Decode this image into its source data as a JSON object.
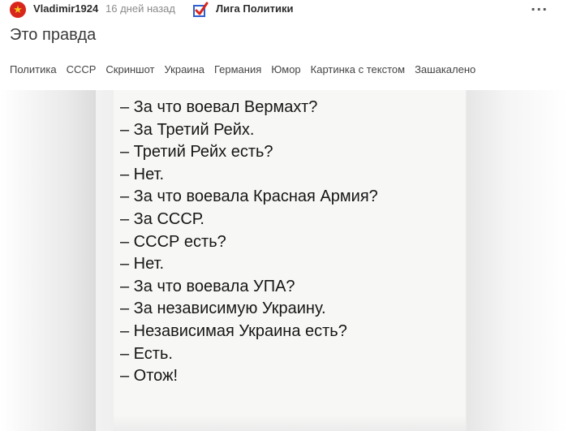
{
  "post": {
    "author": "Vladimir1924",
    "time": "16 дней назад",
    "community": "Лига Политики",
    "title": "Это правда",
    "tags": [
      "Политика",
      "СССР",
      "Скриншот",
      "Украина",
      "Германия",
      "Юмор",
      "Картинка с текстом",
      "Зашакалено"
    ]
  },
  "icons": {
    "avatar": "red-star-avatar-icon",
    "community": "checkbox-tick-icon",
    "more": "more-options-icon"
  },
  "colors": {
    "avatar_bg": "#d9261c",
    "check_blue": "#2f5fd0",
    "check_red": "#d9261c"
  },
  "image_text": {
    "lines": [
      "– За что воевал Вермахт?",
      "– За Третий Рейх.",
      "– Третий Рейх есть?",
      "– Нет.",
      "– За что воевала Красная Армия?",
      "– За СССР.",
      "– СССР есть?",
      "– Нет.",
      "– За что воевала УПА?",
      "– За независимую Украину.",
      "– Независимая Украина есть?",
      "– Есть.",
      "– Отож!"
    ]
  }
}
